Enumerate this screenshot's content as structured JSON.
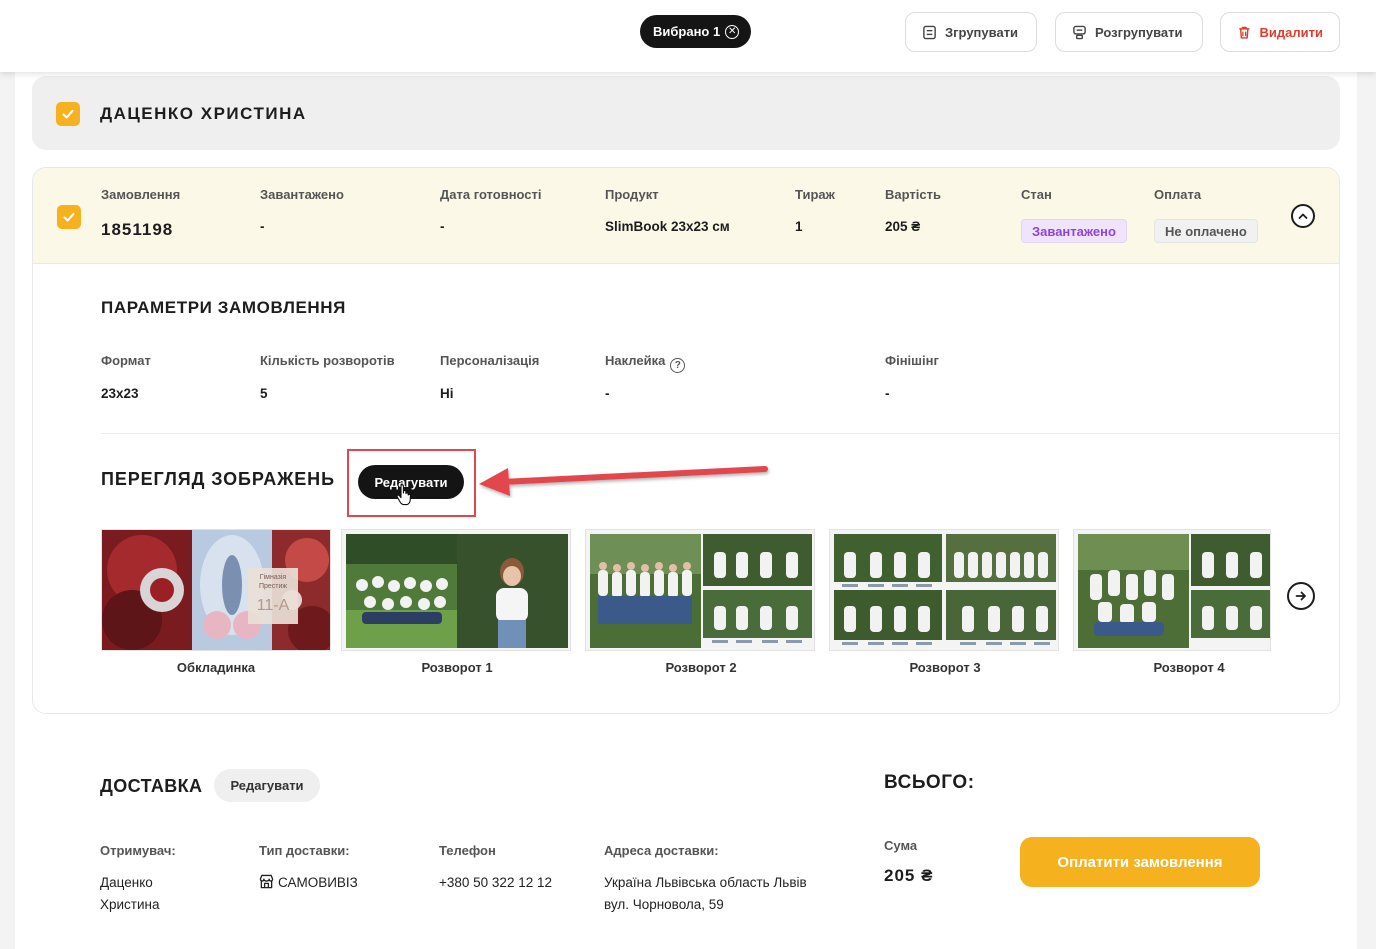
{
  "topbar": {
    "selected_label": "Вибрано 1",
    "group_label": "Згрупувати",
    "ungroup_label": "Розгрупувати",
    "delete_label": "Видалити"
  },
  "group": {
    "name": "ДАЦЕНКО ХРИСТИНА",
    "checked": true
  },
  "order": {
    "checked": true,
    "columns": {
      "order_label": "Замовлення",
      "order_value": "1851198",
      "uploaded_label": "Завантажено",
      "uploaded_value": "-",
      "ready_label": "Дата готовності",
      "ready_value": "-",
      "product_label": "Продукт",
      "product_value": "SlimBook 23x23 см",
      "run_label": "Тираж",
      "run_value": "1",
      "price_label": "Вартість",
      "price_value": "205 ₴",
      "status_label": "Стан",
      "status_value": "Завантажено",
      "payment_label": "Оплата",
      "payment_value": "Не оплачено"
    }
  },
  "params": {
    "title": "ПАРАМЕТРИ ЗАМОВЛЕННЯ",
    "format_label": "Формат",
    "format_value": "23x23",
    "spreads_label": "Кількість розворотів",
    "spreads_value": "5",
    "personalization_label": "Персоналізація",
    "personalization_value": "Hi",
    "sticker_label": "Наклейка",
    "sticker_value": "-",
    "finishing_label": "Фінішінг",
    "finishing_value": "-"
  },
  "preview": {
    "title": "ПЕРЕГЛЯД ЗОБРАЖЕНЬ",
    "edit_label": "Редагувати",
    "cover_text_1": "Гімназія",
    "cover_text_2": "Престиж",
    "cover_text_3": "11-А",
    "thumbs": [
      "Обкладинка",
      "Розворот 1",
      "Розворот 2",
      "Розворот 3",
      "Розворот 4"
    ]
  },
  "delivery": {
    "title": "ДОСТАВКА",
    "edit_label": "Редагувати",
    "recipient_label": "Отримувач:",
    "recipient_line1": "Даценко",
    "recipient_line2": "Христина",
    "type_label": "Тип доставки:",
    "type_value": "САМОВИВІЗ",
    "phone_label": "Телефон",
    "phone_value": "+380 50 322 12 12",
    "address_label": "Адреса доставки:",
    "address_line1": "Україна Львівська область Львів",
    "address_line2": "вул. Чорновола, 59"
  },
  "total": {
    "title": "ВСЬОГО:",
    "sum_label": "Сума",
    "sum_value": "205 ₴",
    "pay_label": "Оплатити замовлення"
  },
  "colors": {
    "accent_yellow": "#f5b21e",
    "status_purple": "#8f45d6",
    "delete_red": "#e23b2e",
    "annotation_red": "#e2474d"
  }
}
